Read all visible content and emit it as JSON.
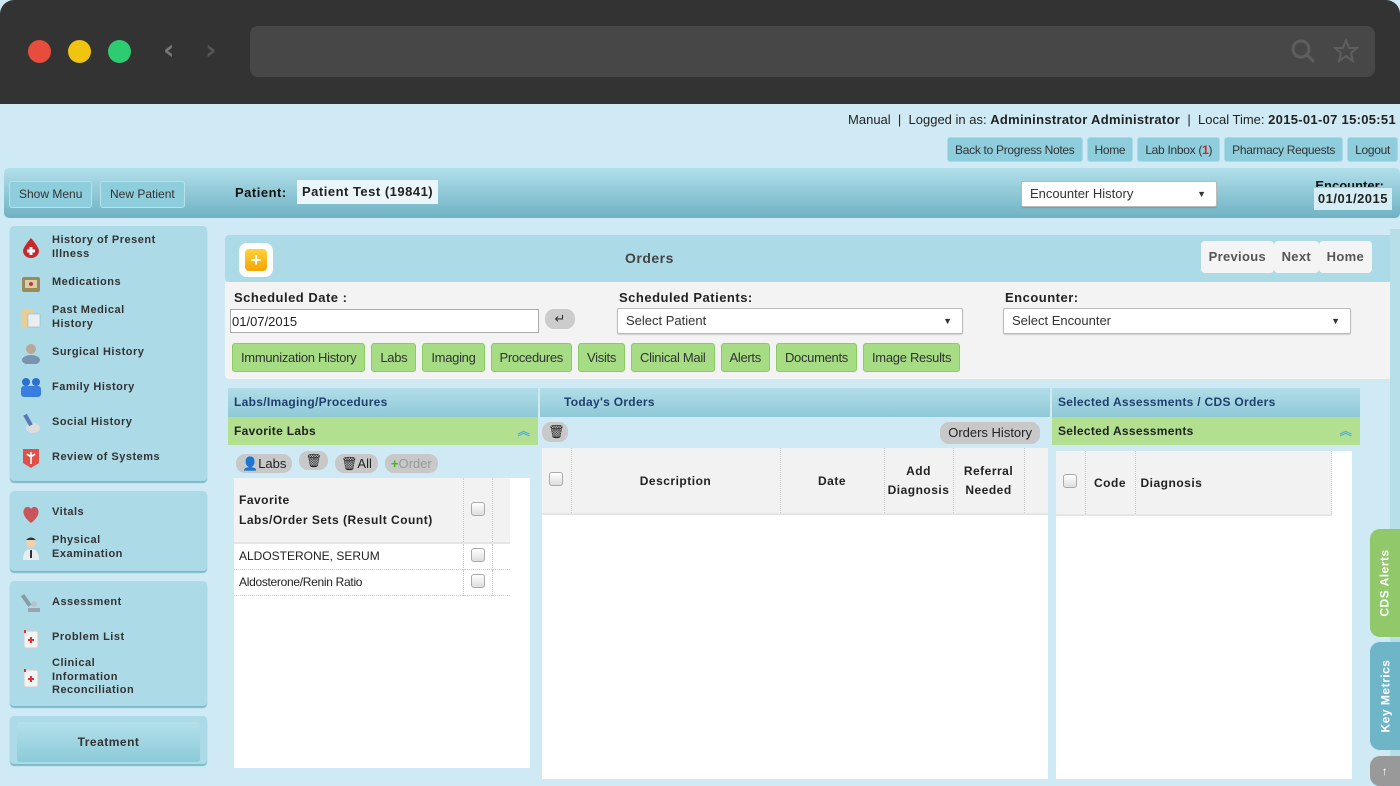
{
  "browser": {
    "url": "",
    "back_icon": "‹",
    "forward_icon": "›",
    "search_icon": "⌕",
    "star_icon": "☆"
  },
  "top": {
    "mode": "Manual",
    "sep": "|",
    "logged_in_label": "Logged in as:",
    "user": "Admininstrator Administrator",
    "time_label": "Local Time:",
    "time": "2015-01-07 15:05:51",
    "links": {
      "back": "Back to Progress Notes",
      "home": "Home",
      "lab_inbox": "Lab Inbox (",
      "lab_count": "1",
      "lab_close": ")",
      "pharmacy": "Pharmacy Requests",
      "logout": "Logout"
    }
  },
  "patient_bar": {
    "show_menu": "Show Menu",
    "new_patient": "New Patient",
    "patient_label": "Patient:",
    "patient_value": "Patient Test (19841)",
    "encounter_history": "Encounter History",
    "encounter_label": "Encounter:",
    "encounter_date": "01/01/2015"
  },
  "sidebar": {
    "group1": [
      {
        "label": "History of Present Illness",
        "icon": "blood-drop"
      },
      {
        "label": "Medications",
        "icon": "medical-kit"
      },
      {
        "label": "Past Medical History",
        "icon": "folder"
      },
      {
        "label": "Surgical History",
        "icon": "surgeon"
      },
      {
        "label": "Family History",
        "icon": "family"
      },
      {
        "label": "Social History",
        "icon": "toilet"
      },
      {
        "label": "Review of Systems",
        "icon": "caduceus"
      }
    ],
    "group2": [
      {
        "label": "Vitals",
        "icon": "heart"
      },
      {
        "label": "Physical Examination",
        "icon": "doctor"
      }
    ],
    "group3": [
      {
        "label": "Assessment",
        "icon": "microscope"
      },
      {
        "label": "Problem List",
        "icon": "medicine-jar"
      },
      {
        "label": "Clinical Information Reconciliation",
        "icon": "medicine-jar"
      }
    ],
    "treatment": "Treatment"
  },
  "orders": {
    "title": "Orders",
    "nav": {
      "previous": "Previous",
      "next": "Next",
      "home": "Home"
    },
    "scheduled_date_label": "Scheduled Date :",
    "scheduled_date_value": "01/07/2015",
    "scheduled_patients_label": "Scheduled Patients:",
    "scheduled_patients_value": "Select Patient",
    "encounter_label": "Encounter:",
    "encounter_value": "Select Encounter",
    "categories": [
      "Immunization History",
      "Labs",
      "Imaging",
      "Procedures",
      "Visits",
      "Clinical Mail",
      "Alerts",
      "Documents",
      "Image Results"
    ]
  },
  "labs_panel": {
    "header": "Labs/Imaging/Procedures",
    "sub": "Favorite Labs",
    "buttons": {
      "labs": "Labs",
      "all": "All",
      "order": "Order"
    },
    "col_header_1": "Favorite",
    "col_header_2": "Labs/Order Sets (Result Count)",
    "rows": [
      "ALDOSTERONE, SERUM",
      "Aldosterone/Renin Ratio"
    ]
  },
  "todays_orders": {
    "header": "Today's Orders",
    "orders_history": "Orders History",
    "columns": {
      "description": "Description",
      "date": "Date",
      "add_dx_1": "Add",
      "add_dx_2": "Diagnosis",
      "ref_1": "Referral",
      "ref_2": "Needed"
    }
  },
  "assessments": {
    "header": "Selected Assessments / CDS Orders",
    "sub": "Selected Assessments",
    "columns": {
      "code": "Code",
      "diagnosis": "Diagnosis"
    }
  },
  "trays": {
    "cds_alerts": "CDS Alerts",
    "key_metrics": "Key Metrics"
  }
}
